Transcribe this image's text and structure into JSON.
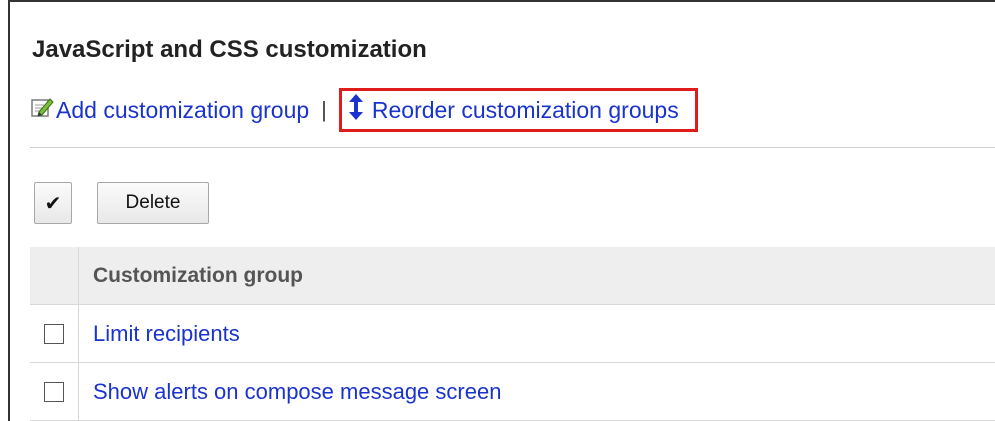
{
  "page": {
    "title": "JavaScript and CSS customization"
  },
  "actions": {
    "add_label": "Add customization group",
    "separator": "|",
    "reorder_label": "Reorder customization groups"
  },
  "toolbar": {
    "check_all_label": "✔",
    "delete_label": "Delete"
  },
  "table": {
    "header": "Customization group",
    "rows": [
      {
        "name": "Limit recipients",
        "checked": false
      },
      {
        "name": "Show alerts on compose message screen",
        "checked": false
      }
    ]
  },
  "colors": {
    "link": "#1a33cc",
    "highlight": "#e01b1b"
  }
}
